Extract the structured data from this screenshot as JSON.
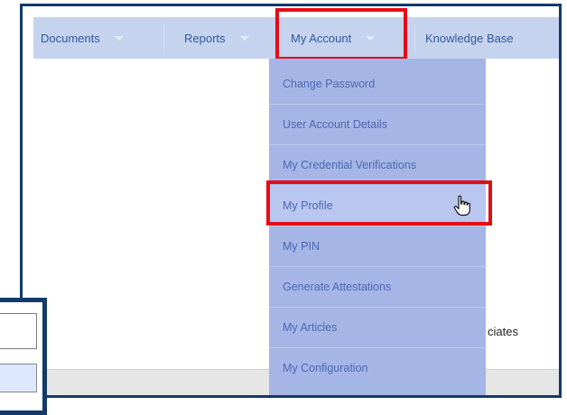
{
  "nav": {
    "items": [
      {
        "label": "Documents"
      },
      {
        "label": "Reports"
      },
      {
        "label": "My Account"
      },
      {
        "label": "Knowledge Base"
      }
    ]
  },
  "dropdown": {
    "items": [
      {
        "label": "Change Password"
      },
      {
        "label": "User Account Details"
      },
      {
        "label": "My Credential Verifications"
      },
      {
        "label": "My Profile"
      },
      {
        "label": "My PIN"
      },
      {
        "label": "Generate Attestations"
      },
      {
        "label": "My Articles"
      },
      {
        "label": "My Configuration"
      }
    ],
    "hovered_item": "My Profile"
  },
  "background": {
    "partial_text": "ciates"
  },
  "colors": {
    "frame_border": "#123a6b",
    "navbar_bg": "#c6d3ee",
    "nav_text": "#31589d",
    "dropdown_bg": "#a5b5e6",
    "highlight_red": "#e30d18"
  },
  "icons": {
    "cursor": "hand-pointer-icon"
  }
}
